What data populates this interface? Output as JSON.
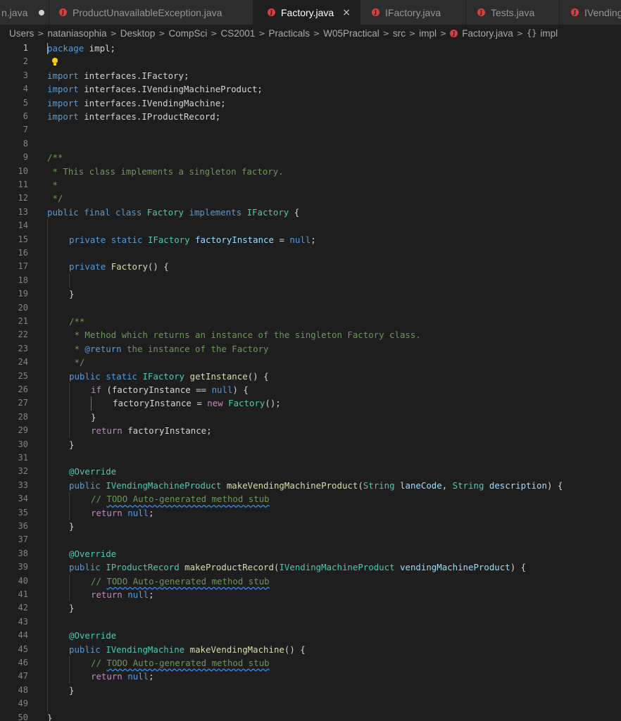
{
  "tabs": [
    {
      "label": "n.java",
      "modified": true,
      "active": false,
      "icon": "java-file-icon"
    },
    {
      "label": "ProductUnavailableException.java",
      "active": false,
      "icon": "java-file-icon"
    },
    {
      "label": "Factory.java",
      "active": true,
      "close": "×",
      "icon": "java-file-icon"
    },
    {
      "label": "IFactory.java",
      "active": false,
      "icon": "java-file-icon"
    },
    {
      "label": "Tests.java",
      "active": false,
      "icon": "java-file-icon"
    },
    {
      "label": "IVending",
      "active": false,
      "icon": "java-file-icon"
    }
  ],
  "breadcrumb": [
    "Users",
    "nataniasophia",
    "Desktop",
    "CompSci",
    "CS2001",
    "Practicals",
    "W05Practical",
    "src",
    "impl",
    "Factory.java",
    "impl"
  ],
  "line_numbers": [
    "1",
    "2",
    "3",
    "4",
    "5",
    "6",
    "7",
    "8",
    "9",
    "10",
    "11",
    "12",
    "13",
    "14",
    "15",
    "16",
    "17",
    "18",
    "19",
    "20",
    "21",
    "22",
    "23",
    "24",
    "25",
    "26",
    "27",
    "28",
    "29",
    "30",
    "31",
    "32",
    "33",
    "34",
    "35",
    "36",
    "37",
    "38",
    "39",
    "40",
    "41",
    "42",
    "43",
    "44",
    "45",
    "46",
    "47",
    "48",
    "49",
    "50"
  ],
  "code": {
    "l1": [
      "package",
      " impl;"
    ],
    "l3": [
      "import",
      " interfaces.IFactory;"
    ],
    "l4": [
      "import",
      " interfaces.IVendingMachineProduct;"
    ],
    "l5": [
      "import",
      " interfaces.IVendingMachine;"
    ],
    "l6": [
      "import",
      " interfaces.IProductRecord;"
    ],
    "l9": [
      "/**"
    ],
    "l10": [
      " * This class implements a singleton factory."
    ],
    "l11": [
      " *"
    ],
    "l12": [
      " */"
    ],
    "l13": [
      "public",
      " ",
      "final",
      " ",
      "class",
      " ",
      "Factory",
      " ",
      "implements",
      " ",
      "IFactory",
      " {"
    ],
    "l15": [
      "private",
      " ",
      "static",
      " ",
      "IFactory",
      " ",
      "factoryInstance",
      " = ",
      "null",
      ";"
    ],
    "l17": [
      "private",
      " ",
      "Factory",
      "() {"
    ],
    "l19": [
      "}"
    ],
    "l21": [
      "/**"
    ],
    "l22": [
      " * Method which returns an instance of the singleton Factory class."
    ],
    "l23": [
      " * ",
      "@return",
      " the instance of the Factory"
    ],
    "l24": [
      " */"
    ],
    "l25": [
      "public",
      " ",
      "static",
      " ",
      "IFactory",
      " ",
      "getInstance",
      "() {"
    ],
    "l26": [
      "if",
      " (factoryInstance == ",
      "null",
      ") {"
    ],
    "l27": [
      "factoryInstance = ",
      "new",
      " ",
      "Factory",
      "();"
    ],
    "l28": [
      "}"
    ],
    "l29": [
      "return",
      " factoryInstance;"
    ],
    "l30": [
      "}"
    ],
    "l32": [
      "@Override"
    ],
    "l33": [
      "public",
      " ",
      "IVendingMachineProduct",
      " ",
      "makeVendingMachineProduct",
      "(",
      "String",
      " ",
      "laneCode",
      ", ",
      "String",
      " ",
      "description",
      ") {"
    ],
    "l34": [
      "// ",
      "TODO Auto-generated method stub"
    ],
    "l35": [
      "return",
      " ",
      "null",
      ";"
    ],
    "l36": [
      "}"
    ],
    "l38": [
      "@Override"
    ],
    "l39": [
      "public",
      " ",
      "IProductRecord",
      " ",
      "makeProductRecord",
      "(",
      "IVendingMachineProduct",
      " ",
      "vendingMachineProduct",
      ") {"
    ],
    "l40": [
      "// ",
      "TODO Auto-generated method stub"
    ],
    "l41": [
      "return",
      " ",
      "null",
      ";"
    ],
    "l42": [
      "}"
    ],
    "l44": [
      "@Override"
    ],
    "l45": [
      "public",
      " ",
      "IVendingMachine",
      " ",
      "makeVendingMachine",
      "() {"
    ],
    "l46": [
      "// ",
      "TODO Auto-generated method stub"
    ],
    "l47": [
      "return",
      " ",
      "null",
      ";"
    ],
    "l48": [
      "}"
    ],
    "l50": [
      "}"
    ]
  },
  "colors": {
    "background": "#1e1e1e",
    "keyword": "#569cd6",
    "control": "#c586c0",
    "type": "#4ec9b0",
    "function": "#dcdcaa",
    "variable": "#9cdcfe",
    "comment": "#6a9955",
    "java_icon": "#d84040"
  }
}
